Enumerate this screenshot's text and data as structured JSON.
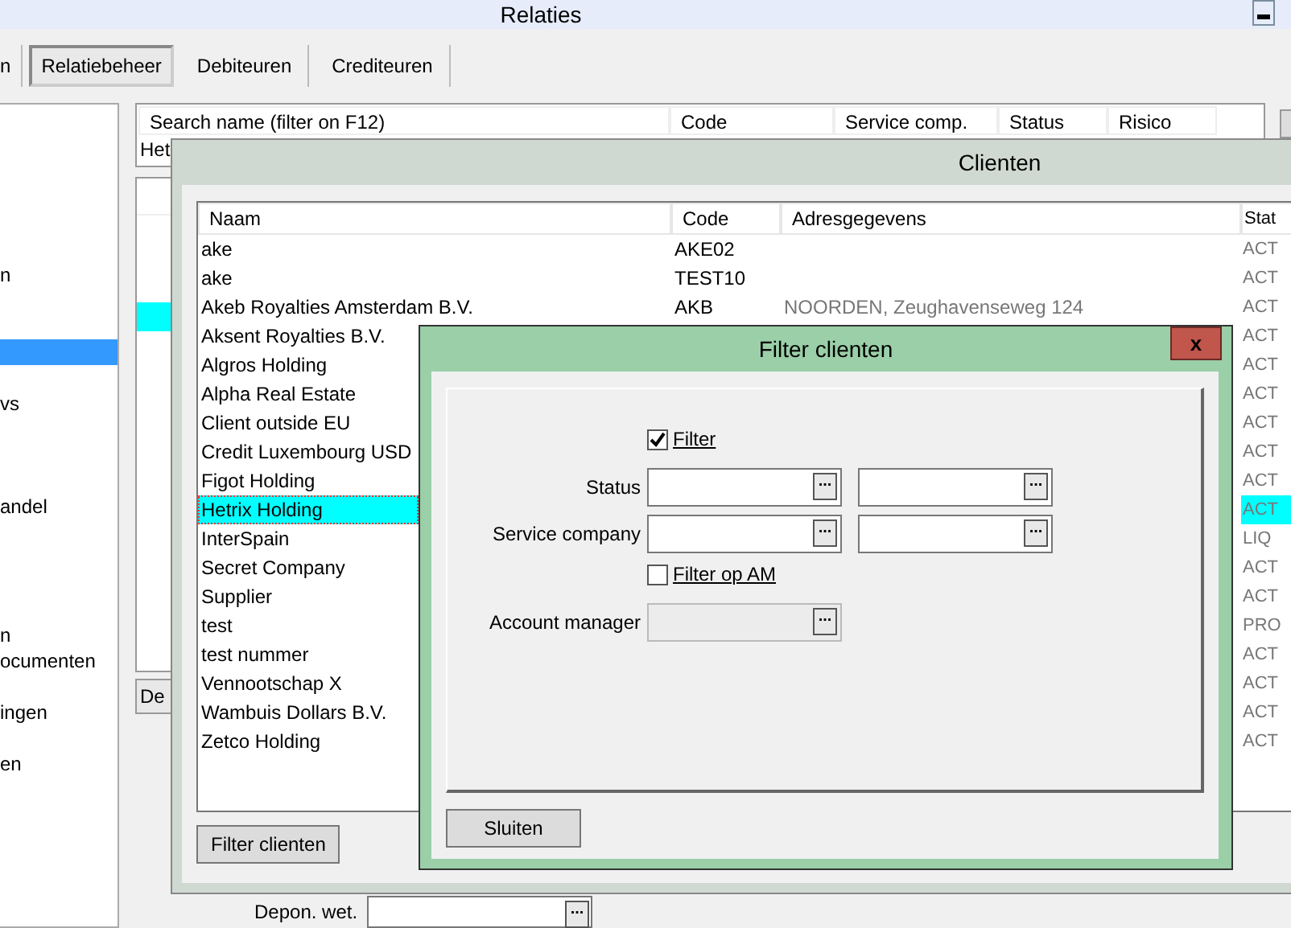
{
  "window": {
    "title": "Relaties"
  },
  "toolbar": {
    "tabs": [
      {
        "label": "n",
        "selected": false
      },
      {
        "label": "Relatiebeheer",
        "selected": true
      },
      {
        "label": "Debiteuren",
        "selected": false
      },
      {
        "label": "Crediteuren",
        "selected": false
      }
    ]
  },
  "sidebar": {
    "items": [
      {
        "label": "n",
        "selected": false
      },
      {
        "selected": true
      },
      {
        "label": "vs",
        "selected": false
      },
      {
        "label": "andel",
        "selected": false
      },
      {
        "label": "n",
        "selected": false
      },
      {
        "label": "ocumenten",
        "selected": false
      },
      {
        "label": "ingen",
        "selected": false
      },
      {
        "label": "en",
        "selected": false
      }
    ]
  },
  "search_table": {
    "columns": [
      "Search name (filter on F12)",
      "Code",
      "Service comp.",
      "Status",
      "Risico"
    ],
    "value": "Het"
  },
  "background_list": {
    "rows": [
      {
        "selected": false
      },
      {
        "selected": false
      },
      {
        "selected": false
      },
      {
        "selected": true
      }
    ]
  },
  "background_button": {
    "label": "De"
  },
  "depon_field": {
    "label": "Depon. wet.",
    "browse": "..."
  },
  "clienten_window": {
    "title": "Clienten",
    "columns": [
      "Naam",
      "Code",
      "Adresgegevens",
      "Stat"
    ],
    "rows": [
      {
        "naam": "ake",
        "code": "AKE02",
        "status": "ACT",
        "selected": false
      },
      {
        "naam": "ake",
        "code": "TEST10",
        "status": "ACT",
        "selected": false
      },
      {
        "naam": "Akeb Royalties Amsterdam B.V.",
        "code": "AKB",
        "adres": "NOORDEN, Zeughavenseweg 124",
        "status": "ACT",
        "selected": false
      },
      {
        "naam": "Aksent Royalties B.V.",
        "status": "ACT",
        "selected": false
      },
      {
        "naam": "Algros Holding",
        "status": "ACT",
        "selected": false
      },
      {
        "naam": "Alpha Real Estate",
        "status": "ACT",
        "selected": false
      },
      {
        "naam": "Client outside EU",
        "status": "ACT",
        "selected": false
      },
      {
        "naam": "Credit Luxembourg USD",
        "status": "ACT",
        "selected": false
      },
      {
        "naam": "Figot Holding",
        "status": "ACT",
        "selected": false
      },
      {
        "naam": "Hetrix Holding",
        "status": "ACT",
        "selected": true
      },
      {
        "naam": "InterSpain",
        "status": "LIQ",
        "selected": false
      },
      {
        "naam": "Secret Company",
        "status": "ACT",
        "selected": false
      },
      {
        "naam": "Supplier",
        "status": "ACT",
        "selected": false
      },
      {
        "naam": "test",
        "status": "PRO",
        "selected": false
      },
      {
        "naam": "test nummer",
        "status": "ACT",
        "selected": false
      },
      {
        "naam": "Vennootschap X",
        "status": "ACT",
        "selected": false
      },
      {
        "naam": "Wambuis Dollars B.V.",
        "status": "ACT",
        "selected": false
      },
      {
        "naam": "Zetco Holding",
        "status": "ACT",
        "selected": false
      }
    ],
    "button": "Filter clienten"
  },
  "filter_dialog": {
    "title": "Filter clienten",
    "close": "x",
    "filter": {
      "label": "Filter",
      "checked": true
    },
    "fields": [
      {
        "label": "Status",
        "browse": [
          "...",
          "..."
        ]
      },
      {
        "label": "Service company",
        "browse": [
          "...",
          "..."
        ]
      }
    ],
    "am_filter": {
      "label": "Filter op AM",
      "checked": false
    },
    "account_manager": {
      "label": "Account manager",
      "browse": "...",
      "disabled": true
    },
    "button": "Sluiten"
  }
}
